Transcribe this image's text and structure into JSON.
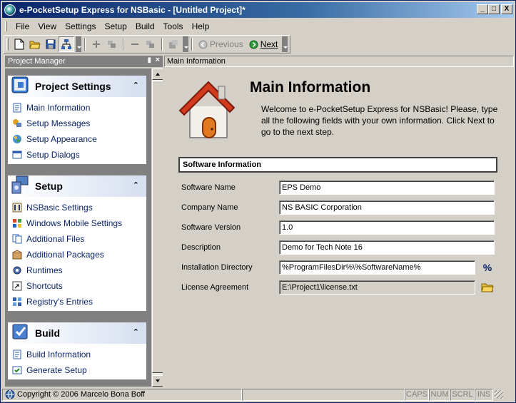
{
  "window": {
    "title": "e-PocketSetup Express for NSBasic - [Untitled Project]*",
    "minimize": "_",
    "maximize": "□",
    "close": "X"
  },
  "menu": [
    "File",
    "View",
    "Settings",
    "Setup",
    "Build",
    "Tools",
    "Help"
  ],
  "toolbar": {
    "previous_label": "Previous",
    "next_label": "Next"
  },
  "project_manager": {
    "title": "Project Manager",
    "pin": "▮",
    "close": "×",
    "groups": [
      {
        "label": "Project Settings",
        "items": [
          "Main Information",
          "Setup Messages",
          "Setup Appearance",
          "Setup Dialogs"
        ]
      },
      {
        "label": "Setup",
        "items": [
          "NSBasic Settings",
          "Windows Mobile Settings",
          "Additional Files",
          "Additional Packages",
          "Runtimes",
          "Shortcuts",
          "Registry's Entries"
        ]
      },
      {
        "label": "Build",
        "items": [
          "Build Information",
          "Generate Setup"
        ]
      }
    ],
    "collapse_glyph": "⌃"
  },
  "main": {
    "tab_label": "Main Information",
    "title": "Main Information",
    "description": "Welcome to e-PocketSetup Express for NSBasic! Please, type all the following fields with your own information. Click Next to go to the next step.",
    "section_title": "Software Information",
    "fields": [
      {
        "label": "Software Name",
        "value": "EPS Demo"
      },
      {
        "label": "Company Name",
        "value": "NS BASIC Corporation"
      },
      {
        "label": "Software Version",
        "value": "1.0"
      },
      {
        "label": "Description",
        "value": "Demo for Tech Note 16"
      },
      {
        "label": "Installation Directory",
        "value": "%ProgramFilesDir%\\%SoftwareName%"
      },
      {
        "label": "License Agreement",
        "value": "E:\\Project1\\license.txt"
      }
    ],
    "percent_button": "%"
  },
  "status": {
    "copyright": "Copyright © 2006 Marcelo Bona Boff",
    "caps": "CAPS",
    "num": "NUM",
    "scrl": "SCRL",
    "ins": "INS"
  },
  "colors": {
    "title_bar": "#0a246a",
    "link": "#0a246a",
    "chrome": "#d4d0c8"
  }
}
